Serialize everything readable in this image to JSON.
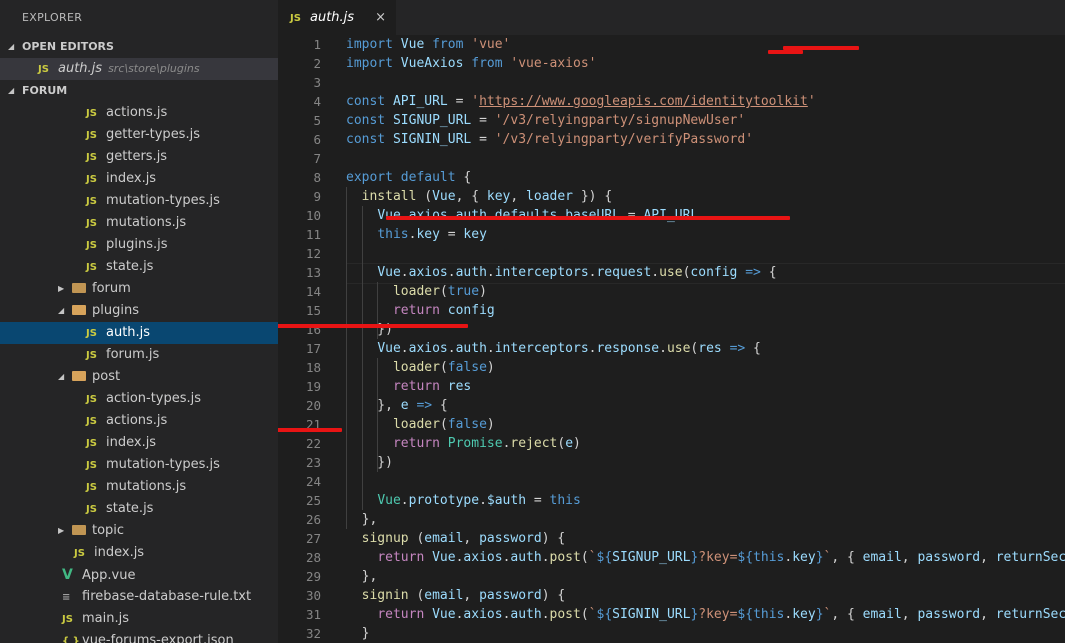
{
  "explorer": {
    "title": "EXPLORER",
    "open_editors_label": "OPEN EDITORS",
    "open_editor": {
      "icon": "JS",
      "name": "auth.js",
      "path": "src\\store\\plugins"
    },
    "project_label": "FORUM"
  },
  "tree": [
    {
      "type": "file",
      "name": "actions.js",
      "icon": "JS"
    },
    {
      "type": "file",
      "name": "getter-types.js",
      "icon": "JS"
    },
    {
      "type": "file",
      "name": "getters.js",
      "icon": "JS"
    },
    {
      "type": "file",
      "name": "index.js",
      "icon": "JS"
    },
    {
      "type": "file",
      "name": "mutation-types.js",
      "icon": "JS"
    },
    {
      "type": "file",
      "name": "mutations.js",
      "icon": "JS"
    },
    {
      "type": "file",
      "name": "plugins.js",
      "icon": "JS"
    },
    {
      "type": "file",
      "name": "state.js",
      "icon": "JS"
    },
    {
      "type": "folder",
      "name": "forum",
      "expanded": false
    },
    {
      "type": "folder",
      "name": "plugins",
      "expanded": true
    },
    {
      "type": "file",
      "name": "auth.js",
      "icon": "JS",
      "selected": true
    },
    {
      "type": "file",
      "name": "forum.js",
      "icon": "JS"
    },
    {
      "type": "folder",
      "name": "post",
      "expanded": true
    },
    {
      "type": "file",
      "name": "action-types.js",
      "icon": "JS"
    },
    {
      "type": "file",
      "name": "actions.js",
      "icon": "JS"
    },
    {
      "type": "file",
      "name": "index.js",
      "icon": "JS"
    },
    {
      "type": "file",
      "name": "mutation-types.js",
      "icon": "JS"
    },
    {
      "type": "file",
      "name": "mutations.js",
      "icon": "JS"
    },
    {
      "type": "file",
      "name": "state.js",
      "icon": "JS"
    },
    {
      "type": "folder",
      "name": "topic",
      "expanded": false
    },
    {
      "type": "file",
      "name": "index.js",
      "icon": "JS"
    },
    {
      "type": "file",
      "name": "App.vue",
      "icon": "V"
    },
    {
      "type": "file",
      "name": "firebase-database-rule.txt",
      "icon": "≡"
    },
    {
      "type": "file",
      "name": "main.js",
      "icon": "JS"
    },
    {
      "type": "file",
      "name": "vue-forums-export.json",
      "icon": "{ }"
    }
  ],
  "tab": {
    "icon": "JS",
    "name": "auth.js",
    "close": "×"
  },
  "code": [
    {
      "n": "1",
      "t": [
        [
          "kw",
          "import"
        ],
        [
          "p",
          " "
        ],
        [
          "var",
          "Vue"
        ],
        [
          "p",
          " "
        ],
        [
          "kw",
          "from"
        ],
        [
          "p",
          " "
        ],
        [
          "str",
          "'vue'"
        ]
      ]
    },
    {
      "n": "2",
      "t": [
        [
          "kw",
          "import"
        ],
        [
          "p",
          " "
        ],
        [
          "var",
          "VueAxios"
        ],
        [
          "p",
          " "
        ],
        [
          "kw",
          "from"
        ],
        [
          "p",
          " "
        ],
        [
          "str",
          "'vue-axios'"
        ]
      ]
    },
    {
      "n": "3",
      "t": []
    },
    {
      "n": "4",
      "t": [
        [
          "kw",
          "const"
        ],
        [
          "p",
          " "
        ],
        [
          "var",
          "API_URL"
        ],
        [
          "p",
          " = "
        ],
        [
          "str",
          "'"
        ],
        [
          "strlink",
          "https://www.googleapis.com/identitytoolkit"
        ],
        [
          "str",
          "'"
        ]
      ]
    },
    {
      "n": "5",
      "t": [
        [
          "kw",
          "const"
        ],
        [
          "p",
          " "
        ],
        [
          "var",
          "SIGNUP_URL"
        ],
        [
          "p",
          " = "
        ],
        [
          "str",
          "'/v3/relyingparty/signupNewUser'"
        ]
      ]
    },
    {
      "n": "6",
      "t": [
        [
          "kw",
          "const"
        ],
        [
          "p",
          " "
        ],
        [
          "var",
          "SIGNIN_URL"
        ],
        [
          "p",
          " = "
        ],
        [
          "str",
          "'/v3/relyingparty/verifyPassword'"
        ]
      ]
    },
    {
      "n": "7",
      "t": []
    },
    {
      "n": "8",
      "t": [
        [
          "kw",
          "export"
        ],
        [
          "p",
          " "
        ],
        [
          "kw",
          "default"
        ],
        [
          "p",
          " {"
        ]
      ]
    },
    {
      "n": "9",
      "t": [
        [
          "p",
          "  "
        ],
        [
          "fn",
          "install"
        ],
        [
          "p",
          " ("
        ],
        [
          "var",
          "Vue"
        ],
        [
          "p",
          ", { "
        ],
        [
          "var",
          "key"
        ],
        [
          "p",
          ", "
        ],
        [
          "var",
          "loader"
        ],
        [
          "p",
          " }) {"
        ]
      ]
    },
    {
      "n": "10",
      "t": [
        [
          "p",
          "    "
        ],
        [
          "var",
          "Vue"
        ],
        [
          "p",
          "."
        ],
        [
          "var",
          "axios"
        ],
        [
          "p",
          "."
        ],
        [
          "var",
          "auth"
        ],
        [
          "p",
          "."
        ],
        [
          "var",
          "defaults"
        ],
        [
          "p",
          "."
        ],
        [
          "var",
          "baseURL"
        ],
        [
          "p",
          " = "
        ],
        [
          "var",
          "API_URL"
        ]
      ]
    },
    {
      "n": "11",
      "t": [
        [
          "p",
          "    "
        ],
        [
          "kw",
          "this"
        ],
        [
          "p",
          "."
        ],
        [
          "var",
          "key"
        ],
        [
          "p",
          " = "
        ],
        [
          "var",
          "key"
        ]
      ]
    },
    {
      "n": "12",
      "t": []
    },
    {
      "n": "13",
      "t": [
        [
          "p",
          "    "
        ],
        [
          "var",
          "Vue"
        ],
        [
          "p",
          "."
        ],
        [
          "var",
          "axios"
        ],
        [
          "p",
          "."
        ],
        [
          "var",
          "auth"
        ],
        [
          "p",
          "."
        ],
        [
          "var",
          "interceptors"
        ],
        [
          "p",
          "."
        ],
        [
          "var",
          "request"
        ],
        [
          "p",
          "."
        ],
        [
          "fn",
          "use"
        ],
        [
          "p",
          "("
        ],
        [
          "var",
          "config"
        ],
        [
          "p",
          " "
        ],
        [
          "kw",
          "=>"
        ],
        [
          "p",
          " {"
        ]
      ]
    },
    {
      "n": "14",
      "t": [
        [
          "p",
          "      "
        ],
        [
          "fn",
          "loader"
        ],
        [
          "p",
          "("
        ],
        [
          "kw",
          "true"
        ],
        [
          "p",
          ")"
        ]
      ]
    },
    {
      "n": "15",
      "t": [
        [
          "p",
          "      "
        ],
        [
          "ctl",
          "return"
        ],
        [
          "p",
          " "
        ],
        [
          "var",
          "config"
        ]
      ]
    },
    {
      "n": "16",
      "t": [
        [
          "p",
          "    })"
        ]
      ]
    },
    {
      "n": "17",
      "t": [
        [
          "p",
          "    "
        ],
        [
          "var",
          "Vue"
        ],
        [
          "p",
          "."
        ],
        [
          "var",
          "axios"
        ],
        [
          "p",
          "."
        ],
        [
          "var",
          "auth"
        ],
        [
          "p",
          "."
        ],
        [
          "var",
          "interceptors"
        ],
        [
          "p",
          "."
        ],
        [
          "var",
          "response"
        ],
        [
          "p",
          "."
        ],
        [
          "fn",
          "use"
        ],
        [
          "p",
          "("
        ],
        [
          "var",
          "res"
        ],
        [
          "p",
          " "
        ],
        [
          "kw",
          "=>"
        ],
        [
          "p",
          " {"
        ]
      ]
    },
    {
      "n": "18",
      "t": [
        [
          "p",
          "      "
        ],
        [
          "fn",
          "loader"
        ],
        [
          "p",
          "("
        ],
        [
          "kw",
          "false"
        ],
        [
          "p",
          ")"
        ]
      ]
    },
    {
      "n": "19",
      "t": [
        [
          "p",
          "      "
        ],
        [
          "ctl",
          "return"
        ],
        [
          "p",
          " "
        ],
        [
          "var",
          "res"
        ]
      ]
    },
    {
      "n": "20",
      "t": [
        [
          "p",
          "    }, "
        ],
        [
          "var",
          "e"
        ],
        [
          "p",
          " "
        ],
        [
          "kw",
          "=>"
        ],
        [
          "p",
          " {"
        ]
      ]
    },
    {
      "n": "21",
      "t": [
        [
          "p",
          "      "
        ],
        [
          "fn",
          "loader"
        ],
        [
          "p",
          "("
        ],
        [
          "kw",
          "false"
        ],
        [
          "p",
          ")"
        ]
      ]
    },
    {
      "n": "22",
      "t": [
        [
          "p",
          "      "
        ],
        [
          "ctl",
          "return"
        ],
        [
          "p",
          " "
        ],
        [
          "cls",
          "Promise"
        ],
        [
          "p",
          "."
        ],
        [
          "fn",
          "reject"
        ],
        [
          "p",
          "("
        ],
        [
          "var",
          "e"
        ],
        [
          "p",
          ")"
        ]
      ]
    },
    {
      "n": "23",
      "t": [
        [
          "p",
          "    })"
        ]
      ]
    },
    {
      "n": "24",
      "t": []
    },
    {
      "n": "25",
      "t": [
        [
          "p",
          "    "
        ],
        [
          "cls",
          "Vue"
        ],
        [
          "p",
          "."
        ],
        [
          "var",
          "prototype"
        ],
        [
          "p",
          "."
        ],
        [
          "var",
          "$auth"
        ],
        [
          "p",
          " = "
        ],
        [
          "kw",
          "this"
        ]
      ]
    },
    {
      "n": "26",
      "t": [
        [
          "p",
          "  },"
        ]
      ]
    },
    {
      "n": "27",
      "t": [
        [
          "p",
          "  "
        ],
        [
          "fn",
          "signup"
        ],
        [
          "p",
          " ("
        ],
        [
          "var",
          "email"
        ],
        [
          "p",
          ", "
        ],
        [
          "var",
          "password"
        ],
        [
          "p",
          ") {"
        ]
      ]
    },
    {
      "n": "28",
      "t": [
        [
          "p",
          "    "
        ],
        [
          "ctl",
          "return"
        ],
        [
          "p",
          " "
        ],
        [
          "var",
          "Vue"
        ],
        [
          "p",
          "."
        ],
        [
          "var",
          "axios"
        ],
        [
          "p",
          "."
        ],
        [
          "var",
          "auth"
        ],
        [
          "p",
          "."
        ],
        [
          "fn",
          "post"
        ],
        [
          "p",
          "("
        ],
        [
          "str",
          "`"
        ],
        [
          "kw",
          "${"
        ],
        [
          "var",
          "SIGNUP_URL"
        ],
        [
          "kw",
          "}"
        ],
        [
          "str",
          "?key="
        ],
        [
          "kw",
          "${"
        ],
        [
          "kw",
          "this"
        ],
        [
          "p",
          "."
        ],
        [
          "var",
          "key"
        ],
        [
          "kw",
          "}"
        ],
        [
          "str",
          "`"
        ],
        [
          "p",
          ", { "
        ],
        [
          "var",
          "email"
        ],
        [
          "p",
          ", "
        ],
        [
          "var",
          "password"
        ],
        [
          "p",
          ", "
        ],
        [
          "var",
          "returnSecureToken"
        ]
      ]
    },
    {
      "n": "29",
      "t": [
        [
          "p",
          "  },"
        ]
      ]
    },
    {
      "n": "30",
      "t": [
        [
          "p",
          "  "
        ],
        [
          "fn",
          "signin"
        ],
        [
          "p",
          " ("
        ],
        [
          "var",
          "email"
        ],
        [
          "p",
          ", "
        ],
        [
          "var",
          "password"
        ],
        [
          "p",
          ") {"
        ]
      ]
    },
    {
      "n": "31",
      "t": [
        [
          "p",
          "    "
        ],
        [
          "ctl",
          "return"
        ],
        [
          "p",
          " "
        ],
        [
          "var",
          "Vue"
        ],
        [
          "p",
          "."
        ],
        [
          "var",
          "axios"
        ],
        [
          "p",
          "."
        ],
        [
          "var",
          "auth"
        ],
        [
          "p",
          "."
        ],
        [
          "fn",
          "post"
        ],
        [
          "p",
          "("
        ],
        [
          "str",
          "`"
        ],
        [
          "kw",
          "${"
        ],
        [
          "var",
          "SIGNIN_URL"
        ],
        [
          "kw",
          "}"
        ],
        [
          "str",
          "?key="
        ],
        [
          "kw",
          "${"
        ],
        [
          "kw",
          "this"
        ],
        [
          "p",
          "."
        ],
        [
          "var",
          "key"
        ],
        [
          "kw",
          "}"
        ],
        [
          "str",
          "`"
        ],
        [
          "p",
          ", { "
        ],
        [
          "var",
          "email"
        ],
        [
          "p",
          ", "
        ],
        [
          "var",
          "password"
        ],
        [
          "p",
          ", "
        ],
        [
          "var",
          "returnSecureToken"
        ]
      ]
    },
    {
      "n": "32",
      "t": [
        [
          "p",
          "  }"
        ]
      ]
    }
  ],
  "colors": {
    "annotation": "#e81414",
    "selection": "#094771"
  }
}
